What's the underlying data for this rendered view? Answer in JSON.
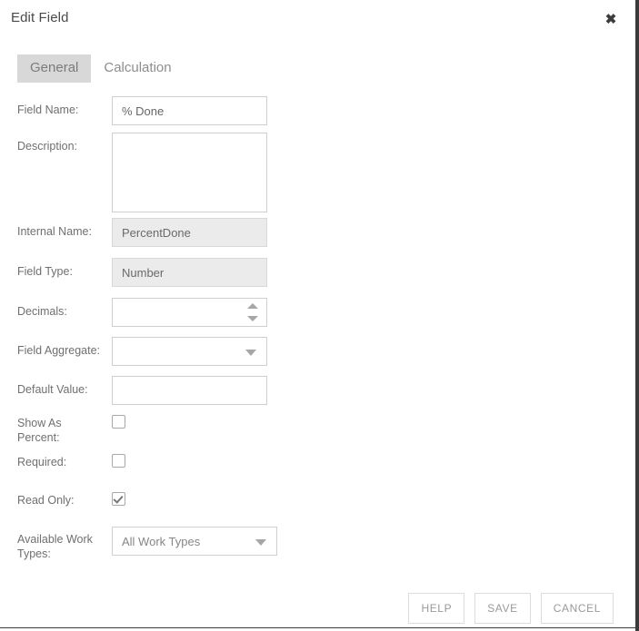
{
  "dialog": {
    "title": "Edit Field",
    "close_icon": "close-icon",
    "close_glyph": "✖"
  },
  "tabs": [
    {
      "label": "General",
      "active": true
    },
    {
      "label": "Calculation",
      "active": false
    }
  ],
  "form": {
    "field_name": {
      "label": "Field Name:",
      "value": "% Done",
      "placeholder": ""
    },
    "description": {
      "label": "Description:",
      "value": "",
      "placeholder": ""
    },
    "internal_name": {
      "label": "Internal Name:",
      "value": "PercentDone"
    },
    "field_type": {
      "label": "Field Type:",
      "value": "Number"
    },
    "decimals": {
      "label": "Decimals:",
      "value": "",
      "placeholder": "",
      "spinner_up_icon": "chevron-up-icon",
      "spinner_down_icon": "chevron-down-icon"
    },
    "field_aggregate": {
      "label": "Field Aggregate:",
      "value": "",
      "caret_icon": "chevron-down-icon"
    },
    "default_value": {
      "label": "Default Value:",
      "value": "",
      "placeholder": ""
    },
    "show_as_percent": {
      "label": "Show As Percent:",
      "checked": false
    },
    "required": {
      "label": "Required:",
      "checked": false
    },
    "read_only": {
      "label": "Read Only:",
      "checked": true
    },
    "available_work_types": {
      "label": "Available Work Types:",
      "value": "All Work Types",
      "caret_icon": "chevron-down-icon"
    }
  },
  "footer": {
    "help_label": "HELP",
    "save_label": "SAVE",
    "cancel_label": "CANCEL"
  },
  "colors": {
    "text": "#6f6f6f",
    "border": "#cfcfcf",
    "disabled_bg": "#ebebeb",
    "tab_active_bg": "#d8d8d8",
    "edge": "#3b3b3b"
  }
}
